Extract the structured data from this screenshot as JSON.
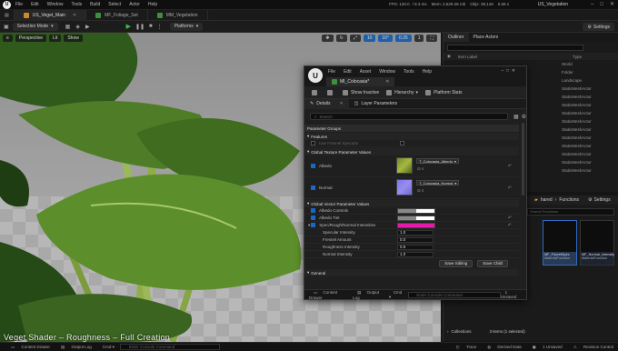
{
  "app": {
    "menu": [
      "File",
      "Edit",
      "Window",
      "Tools",
      "Build",
      "Select",
      "Actor",
      "Help"
    ],
    "stats": {
      "fps": "FPS: 120.0",
      "ms": "/ 8.3 ms",
      "mem": "Mem: 2,629.28 mb",
      "objs": "Objs: 39,149",
      "vram": "0.68 s"
    },
    "project_name": "US_Vegetation"
  },
  "tabs": [
    {
      "label": "US_Veget_Main",
      "color": "#d08a2a"
    },
    {
      "label": "MF_Foliage_Set",
      "color": "#3e8f3e"
    },
    {
      "label": "MM_Vegetation",
      "color": "#3e8f3e"
    }
  ],
  "toolbar": {
    "mode": "Selection Mode",
    "platforms": "Platforms",
    "settings": "Settings"
  },
  "viewport": {
    "perspective": "Perspective",
    "lit": "Lit",
    "show": "Show",
    "grid_snap": "10",
    "rot_snap": "10°",
    "scale_snap": "0.25",
    "cam_speed": "1",
    "caption": "Veget Shader – Roughness – Full Creation"
  },
  "outliner": {
    "tab_outliner": "Outliner",
    "tab_place": "Place Actors",
    "col_label": "Item Label",
    "col_type": "Type",
    "types": [
      "World",
      "Folder",
      "Landscape",
      "StaticMeshActor",
      "StaticMeshActor",
      "StaticMeshActor",
      "StaticMeshActor",
      "StaticMeshActor",
      "StaticMeshActor",
      "StaticMeshActor",
      "StaticMeshActor",
      "StaticMeshActor",
      "StaticMeshActor",
      "StaticMeshActor"
    ]
  },
  "content_browser": {
    "path": "hared",
    "functions": "Functions",
    "settings": "Settings",
    "search": "Search Functions",
    "items": [
      {
        "name": "MF_FrizzetSpec",
        "type": "MaterialFunction"
      },
      {
        "name": "MF_Normal_Intensity",
        "type": "MaterialFunction"
      }
    ],
    "collections": "Collections",
    "count": "3 items (1 selected)"
  },
  "material_window": {
    "menu": [
      "File",
      "Edit",
      "Asset",
      "Window",
      "Tools",
      "Help"
    ],
    "tab": "MI_Colocasia*",
    "toolbar": {
      "show_inactive": "Show Inactive",
      "hierarchy": "Hierarchy",
      "platform": "Platform Stats"
    },
    "subtabs": {
      "details": "Details",
      "layer_params": "Layer Parameters"
    },
    "search_placeholder": "Search",
    "groups": {
      "parameter_groups": "Parameter Groups",
      "features": "Features",
      "use_fresnel": "Use Fresnel Specular",
      "texture_values": "Global Texture Parameter Values",
      "albedo": "Albedo",
      "albedo_tex": "T_Colocasia_Albedo",
      "normal": "Normal",
      "normal_tex": "T_Colocasia_Normal",
      "vector_values": "Global Vector Parameter Values",
      "albedo_controls": "Albedo Controls",
      "albedo_tint": "Albedo Tint",
      "spec_rough": "Spec/Rough/Normal Intensities",
      "spec_intensity": "Specular Intensity",
      "spec_val": "1.0",
      "fresnel_amount": "Fresnel Amount",
      "fresnel_val": "0.0",
      "roughness_intensity": "Roughness Intensity",
      "rough_val": "0.5",
      "normal_intensity": "Normal Intensity",
      "normal_val": "1.0",
      "general": "General"
    },
    "buttons": {
      "save_sibling": "Save Sibling",
      "save_child": "Save Child"
    },
    "bottom": {
      "content_drawer": "Content Drawer",
      "output_log": "Output Log",
      "cmd": "Cmd",
      "console": "Enter Console Command",
      "unsaved": "1 Unsaved"
    },
    "colors": {
      "tint": "#e61aa8",
      "swatch_white": "#ffffff"
    }
  },
  "statusbar": {
    "content_drawer": "Content Drawer",
    "output_log": "Output Log",
    "cmd": "Cmd",
    "console": "Enter Console Command",
    "trace": "Trace",
    "derived_data": "Derived Data",
    "unsaved": "1 Unsaved",
    "revision": "Revision Control"
  }
}
